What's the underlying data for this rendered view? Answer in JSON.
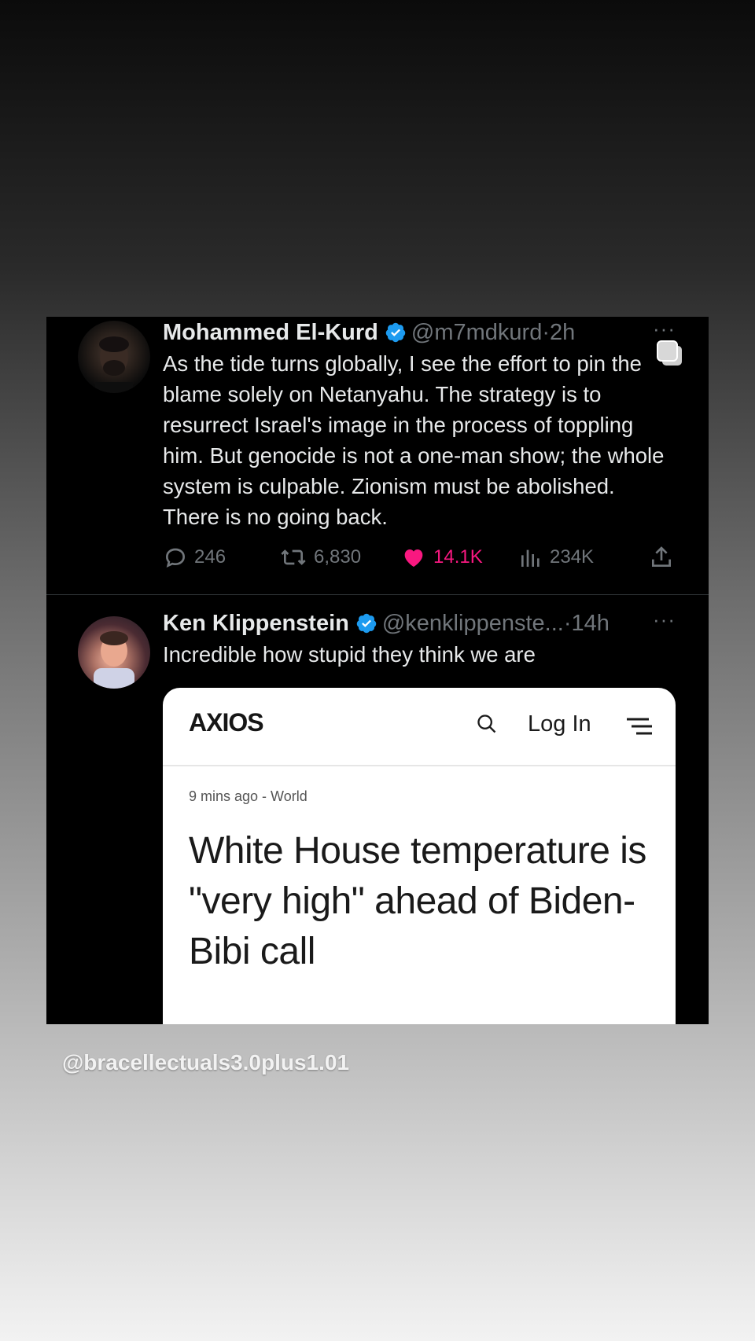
{
  "tweets": [
    {
      "name": "Mohammed El-Kurd",
      "handle": "@m7mdkurd",
      "separator": "·",
      "time": "2h",
      "text": "As the tide turns globally, I see the effort to pin the blame solely on Netanyahu. The strategy is to resurrect Israel's image in the process of toppling him. But genocide is not a one-man show; the whole system is culpable. Zionism must be abolished. There is no going back.",
      "replies": "246",
      "reposts": "6,830",
      "likes": "14.1K",
      "views": "234K",
      "more": "···"
    },
    {
      "name": "Ken Klippenstein",
      "handle": "@kenklippenste...",
      "separator": "·",
      "time": "14h",
      "text": "Incredible how stupid they think we are",
      "more": "···",
      "embed": {
        "logo": "AXIOS",
        "login": "Log In",
        "meta": "9 mins ago - World",
        "headline": "White House temperature is \"very high\" ahead of Biden-Bibi call"
      }
    }
  ],
  "colors": {
    "like": "#f91880",
    "verified": "#1d9bf0",
    "muted": "#71767b"
  },
  "watermark": "@bracellectuals3.0plus1.01"
}
